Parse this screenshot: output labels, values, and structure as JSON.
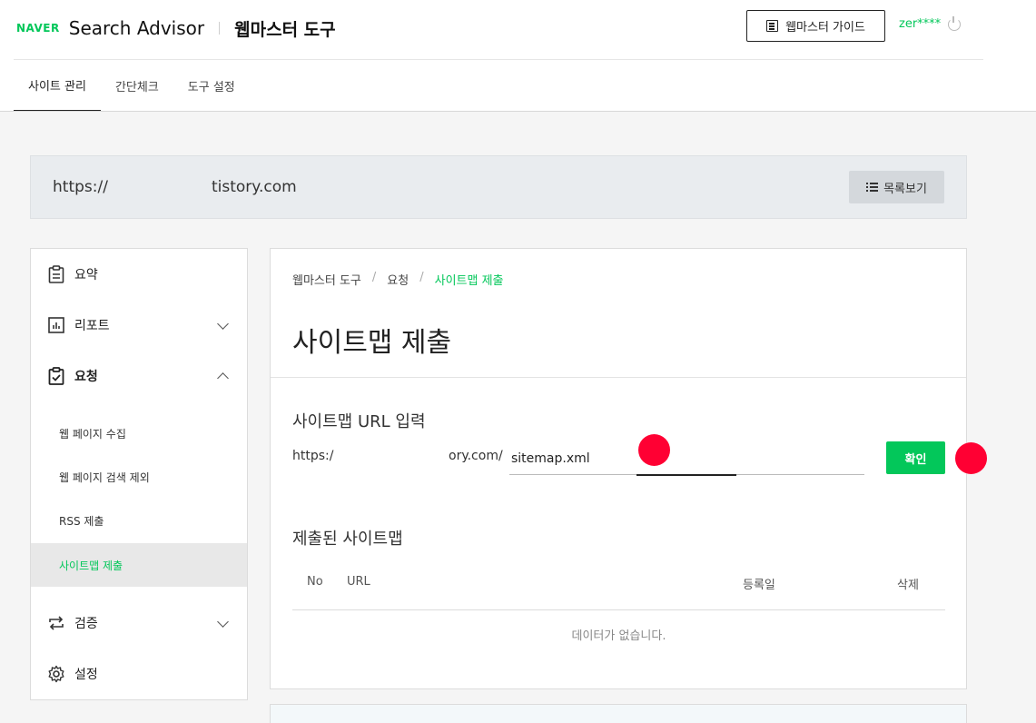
{
  "header": {
    "brand": "NAVER",
    "product": "Search Advisor",
    "tool_title": "웹마스터 도구",
    "guide_button": "웹마스터 가이드",
    "user": "zer****"
  },
  "tabs": [
    {
      "label": "사이트 관리",
      "active": true
    },
    {
      "label": "간단체크",
      "active": false
    },
    {
      "label": "도구 설정",
      "active": false
    }
  ],
  "site_bar": {
    "protocol": "https://",
    "domain": "tistory.com",
    "list_button": "목록보기"
  },
  "sidebar": {
    "summary": "요약",
    "report": "리포트",
    "request": "요청",
    "sub_items": [
      {
        "label": "웹 페이지 수집"
      },
      {
        "label": "웹 페이지 검색 제외"
      },
      {
        "label": "RSS 제출"
      },
      {
        "label": "사이트맵 제출"
      }
    ],
    "verify": "검증",
    "settings": "설정"
  },
  "main": {
    "breadcrumb": [
      "웹마스터 도구",
      "요청",
      "사이트맵 제출"
    ],
    "title": "사이트맵 제출",
    "input_section_title": "사이트맵 URL 입력",
    "url_prefix_start": "https:/",
    "url_prefix_end": "ory.com/",
    "input_value": "sitemap.xml",
    "confirm_button": "확인",
    "submitted_title": "제출된 사이트맵",
    "table_headers": {
      "no": "No",
      "url": "URL",
      "date": "등록일",
      "delete": "삭제"
    },
    "empty_message": "데이터가 없습니다."
  },
  "colors": {
    "accent": "#03c75a",
    "marker": "#ff0033"
  }
}
